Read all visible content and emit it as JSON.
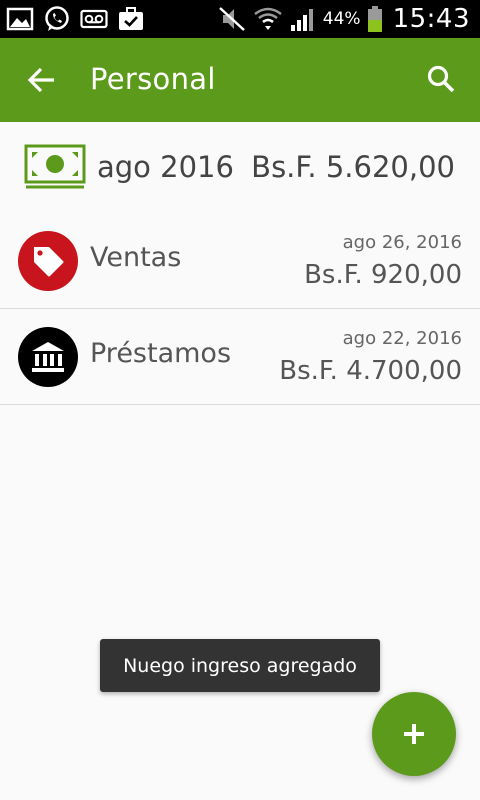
{
  "status_bar": {
    "battery_percent": "44%",
    "time": "15:43"
  },
  "app_bar": {
    "title": "Personal",
    "back_icon": "arrow-back-icon",
    "search_icon": "search-icon"
  },
  "summary": {
    "icon": "money-bill-icon",
    "month": "ago 2016",
    "total": "Bs.F. 5.620,00"
  },
  "entries": [
    {
      "category": "Ventas",
      "icon": "tag-icon",
      "icon_color": "#c8141c",
      "date": "ago 26, 2016",
      "amount": "Bs.F. 920,00"
    },
    {
      "category": "Préstamos",
      "icon": "bank-icon",
      "icon_color": "#000000",
      "date": "ago 22, 2016",
      "amount": "Bs.F. 4.700,00"
    }
  ],
  "toast": {
    "message": "Nuego ingreso agregado"
  },
  "fab": {
    "icon": "plus-icon"
  },
  "colors": {
    "primary": "#5c9a1c",
    "background": "#fafafa"
  }
}
